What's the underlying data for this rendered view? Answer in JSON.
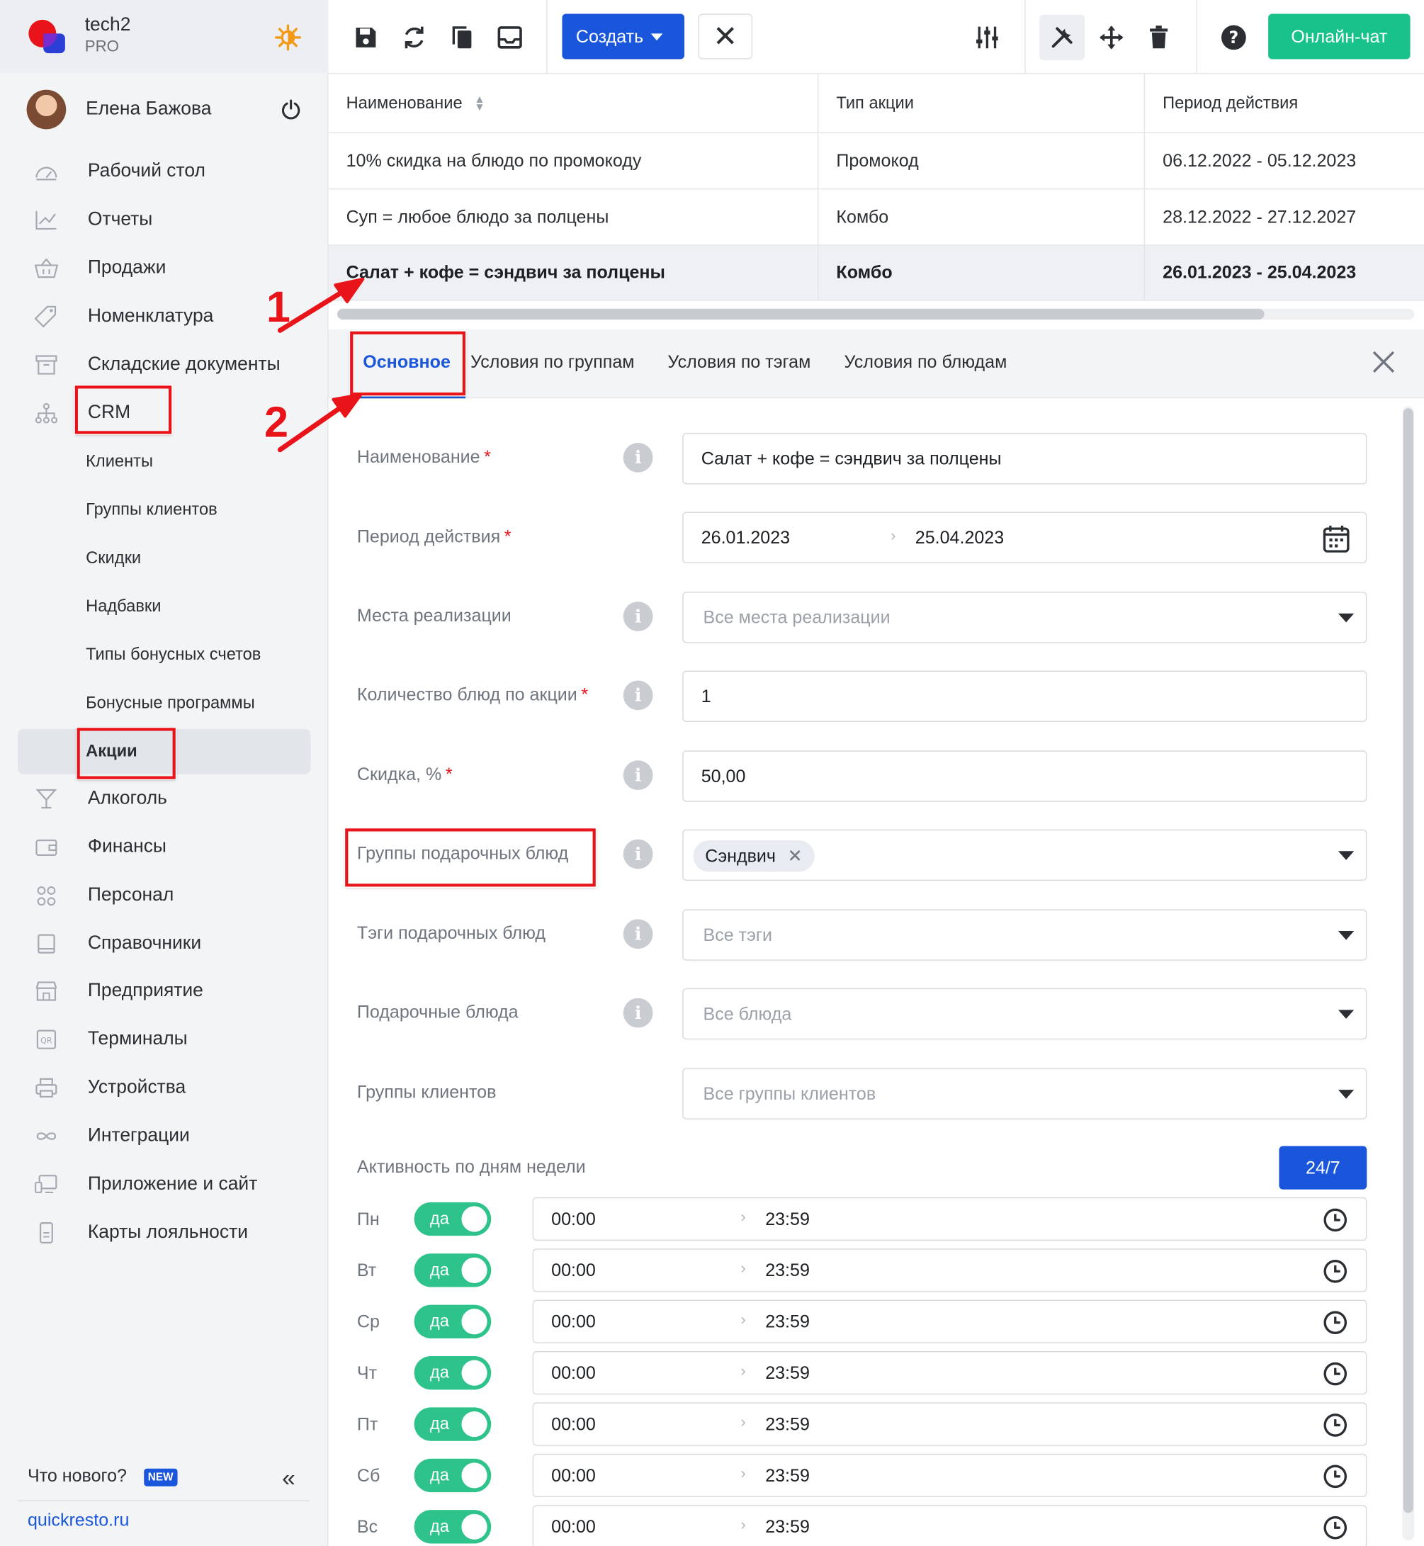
{
  "brand": {
    "name": "tech2",
    "plan": "PRO"
  },
  "user": {
    "name": "Елена Бажова"
  },
  "sidebar": {
    "items": [
      {
        "label": "Рабочий стол",
        "icon": "dashboard-icon"
      },
      {
        "label": "Отчеты",
        "icon": "chart-icon"
      },
      {
        "label": "Продажи",
        "icon": "basket-icon"
      },
      {
        "label": "Номенклатура",
        "icon": "tag-icon"
      },
      {
        "label": "Складские документы",
        "icon": "archive-icon"
      },
      {
        "label": "CRM",
        "icon": "hierarchy-icon"
      }
    ],
    "crm_sub": [
      "Клиенты",
      "Группы клиентов",
      "Скидки",
      "Надбавки",
      "Типы бонусных счетов",
      "Бонусные программы",
      "Акции"
    ],
    "items2": [
      {
        "label": "Алкоголь",
        "icon": "cocktail-icon"
      },
      {
        "label": "Финансы",
        "icon": "wallet-icon"
      },
      {
        "label": "Персонал",
        "icon": "people-icon"
      },
      {
        "label": "Справочники",
        "icon": "book-icon"
      },
      {
        "label": "Предприятие",
        "icon": "store-icon"
      },
      {
        "label": "Терминалы",
        "icon": "qr-icon"
      },
      {
        "label": "Устройства",
        "icon": "printer-icon"
      },
      {
        "label": "Интеграции",
        "icon": "infinity-icon"
      },
      {
        "label": "Приложение и сайт",
        "icon": "monitor-icon"
      },
      {
        "label": "Карты лояльности",
        "icon": "card-icon"
      }
    ],
    "whats_new": "Что нового?",
    "new_badge": "NEW",
    "collapse": "«",
    "site": "quickresto.ru"
  },
  "toolbar": {
    "create_label": "Создать",
    "cancel_label": "✕",
    "chat_label": "Онлайн-чат"
  },
  "table": {
    "headers": [
      "Наименование",
      "Тип акции",
      "Период действия"
    ],
    "rows": [
      [
        "10% скидка на блюдо по промокоду",
        "Промокод",
        "06.12.2022 - 05.12.2023"
      ],
      [
        "Суп = любое блюдо за полцены",
        "Комбо",
        "28.12.2022 - 27.12.2027"
      ],
      [
        "Салат + кофе = сэндвич за полцены",
        "Комбо",
        "26.01.2023 - 25.04.2023"
      ]
    ],
    "selected_row": 2
  },
  "tabs": [
    "Основное",
    "Условия по группам",
    "Условия по тэгам",
    "Условия по блюдам"
  ],
  "form": {
    "name_label": "Наименование",
    "name_value": "Салат + кофе = сэндвич за полцены",
    "period_label": "Период действия",
    "period_from": "26.01.2023",
    "period_to": "25.04.2023",
    "places_label": "Места реализации",
    "places_placeholder": "Все места реализации",
    "qty_label": "Количество блюд по акции",
    "qty_value": "1",
    "discount_label": "Скидка, %",
    "discount_value": "50,00",
    "gift_groups_label": "Группы подарочных блюд",
    "gift_groups_tag": "Сэндвич",
    "gift_tags_label": "Тэги подарочных блюд",
    "gift_tags_placeholder": "Все тэги",
    "gift_dishes_label": "Подарочные блюда",
    "gift_dishes_placeholder": "Все блюда",
    "client_groups_label": "Группы клиентов",
    "client_groups_placeholder": "Все группы клиентов",
    "activity_label": "Активность по дням недели",
    "btn_247": "24/7",
    "days": [
      {
        "day": "Пн",
        "on": "да",
        "from": "00:00",
        "to": "23:59"
      },
      {
        "day": "Вт",
        "on": "да",
        "from": "00:00",
        "to": "23:59"
      },
      {
        "day": "Ср",
        "on": "да",
        "from": "00:00",
        "to": "23:59"
      },
      {
        "day": "Чт",
        "on": "да",
        "from": "00:00",
        "to": "23:59"
      },
      {
        "day": "Пт",
        "on": "да",
        "from": "00:00",
        "to": "23:59"
      },
      {
        "day": "Сб",
        "on": "да",
        "from": "00:00",
        "to": "23:59"
      },
      {
        "day": "Вс",
        "on": "да",
        "from": "00:00",
        "to": "23:59"
      }
    ]
  },
  "annotations": {
    "step1": "1",
    "step2": "2"
  },
  "colors": {
    "accent": "#1a56db",
    "success": "#19c28a",
    "toggle": "#2dc38a",
    "highlight": "#e8141a"
  }
}
